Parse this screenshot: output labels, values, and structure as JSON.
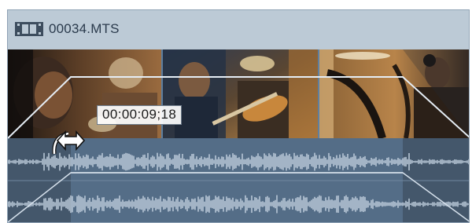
{
  "clip": {
    "name": "00034.MTS",
    "header_icon": "film-strip-icon",
    "timecode_tooltip": "00:00:09;18",
    "cursor_icon": "fade-handle-cursor-icon",
    "selected": true,
    "colors": {
      "header_bg": "#bccad6",
      "audio_bg": "#546d87",
      "waveform": "#b7c6d6",
      "fade_line": "#dfe8f1",
      "thumbnail_border": "#5e7fa0"
    }
  },
  "video_track": {
    "thumbnails": [
      {
        "name": "thumbnail-1",
        "description_icon": "drummer-frame"
      },
      {
        "name": "thumbnail-2",
        "description_icon": "guitarist-frame"
      },
      {
        "name": "thumbnail-3",
        "description_icon": "microphone-frame"
      }
    ]
  },
  "audio_track": {
    "channels": [
      "left",
      "right"
    ]
  }
}
